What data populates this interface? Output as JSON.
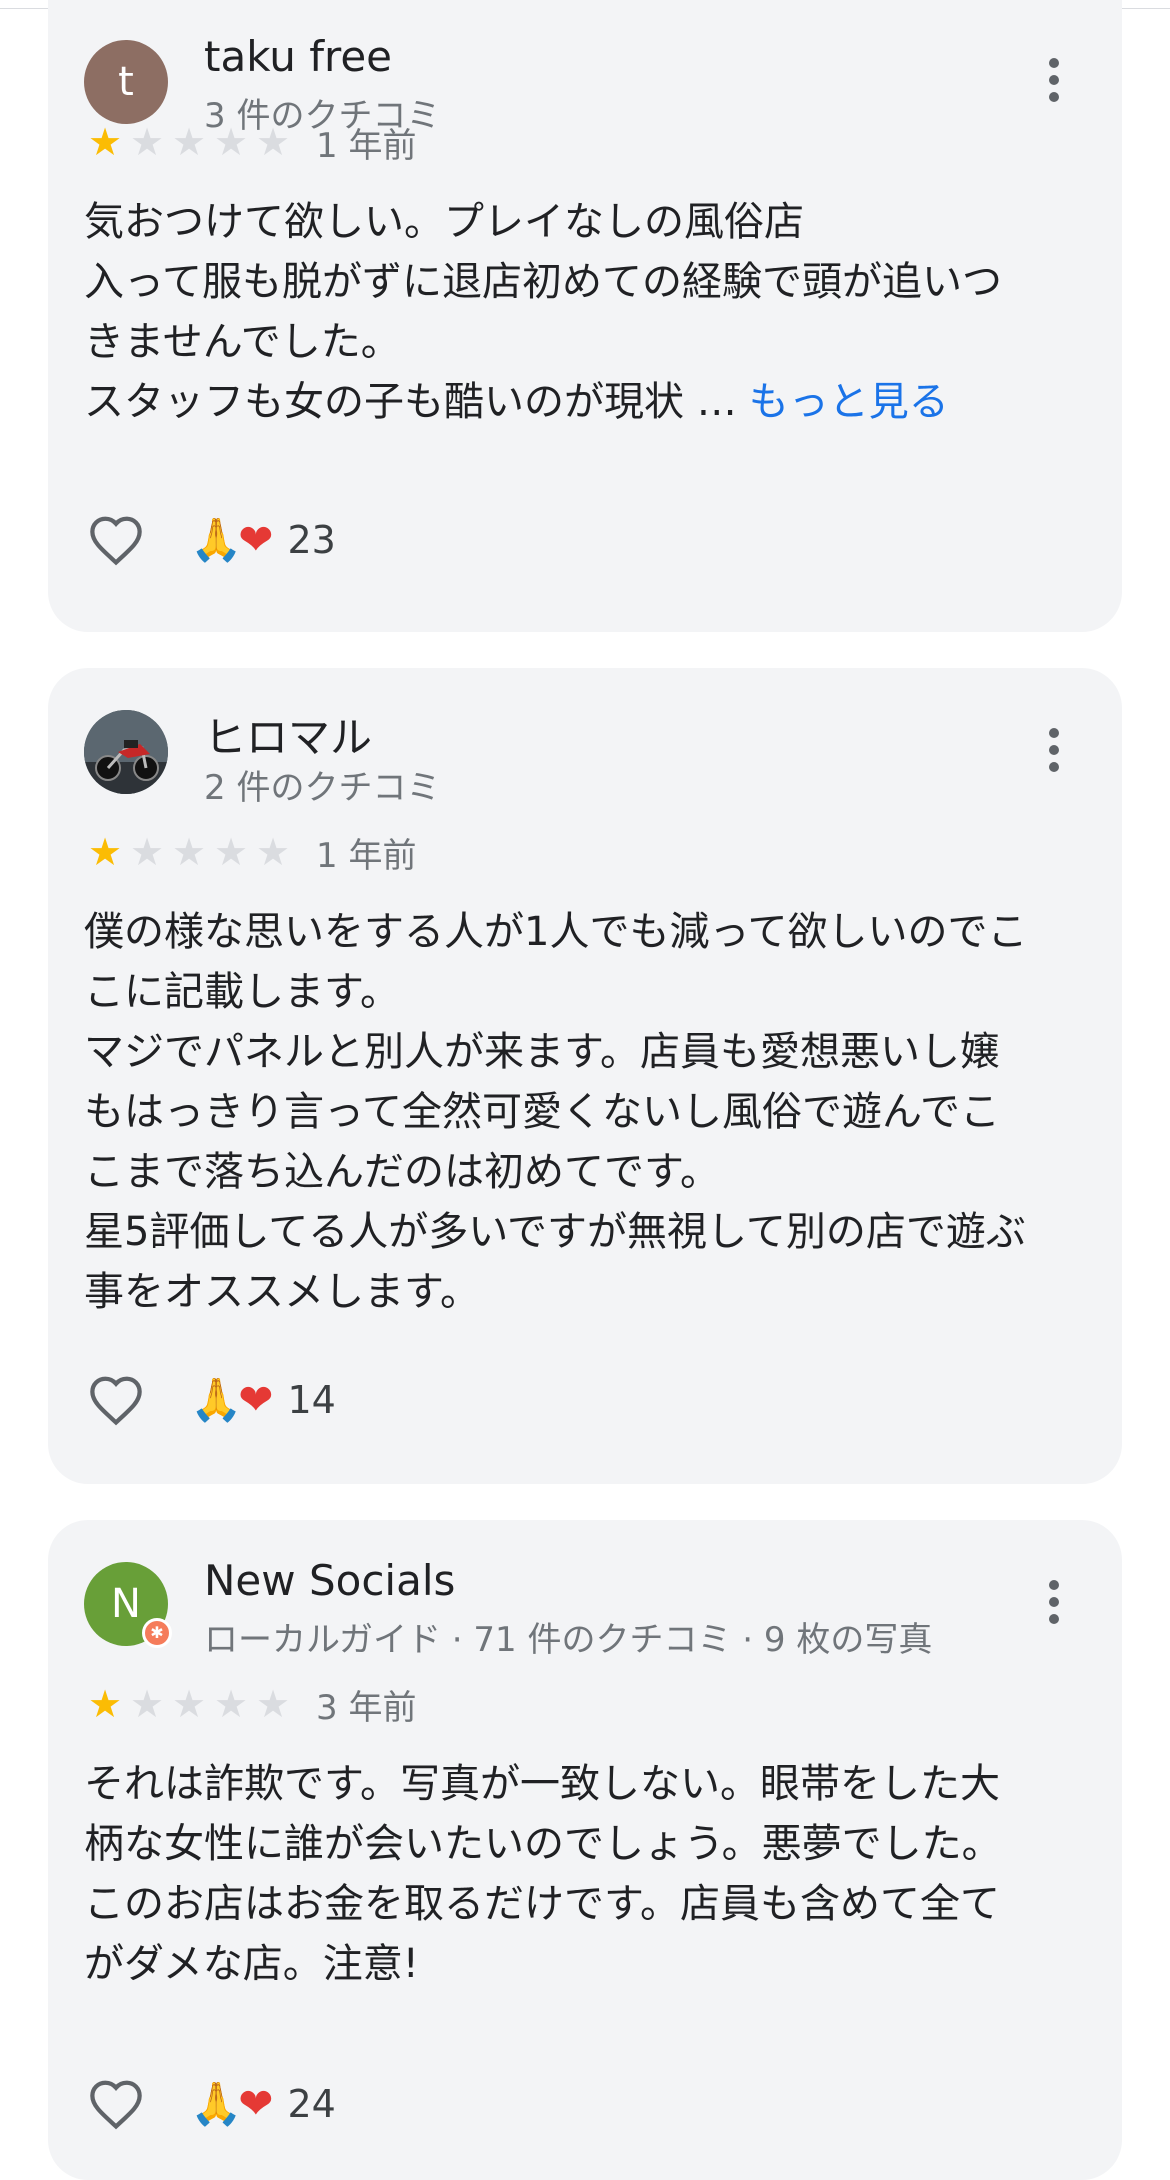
{
  "reviews": [
    {
      "avatar_letter": "t",
      "name": "taku free",
      "meta": "3 件のクチコミ",
      "stars": 1,
      "date": "1 年前",
      "lines": [
        "気おつけて欲しい。プレイなしの風俗店",
        "入って服も脱がずに退店初めての経験で頭が追いつ",
        "きませんでした。",
        "スタッフも女の子も酷いのが現状 …"
      ],
      "more_label": "もっと見る",
      "reaction_emojis": [
        "🙏",
        "❤"
      ],
      "reaction_count": "23"
    },
    {
      "avatar_letter": "",
      "avatar_icon": "motorcycle-photo",
      "name": "ヒロマル",
      "meta": "2 件のクチコミ",
      "stars": 1,
      "date": "1 年前",
      "lines": [
        "僕の様な思いをする人が1人でも減って欲しいのでこ",
        "こに記載します。",
        "マジでパネルと別人が来ます。店員も愛想悪いし嬢",
        "もはっきり言って全然可愛くないし風俗で遊んでこ",
        "こまで落ち込んだのは初めてです。",
        "星5評価してる人が多いですが無視して別の店で遊ぶ",
        "事をオススメします。"
      ],
      "reaction_emojis": [
        "🙏",
        "❤"
      ],
      "reaction_count": "14"
    },
    {
      "avatar_letter": "N",
      "name": "New Socials",
      "meta": "ローカルガイド · 71 件のクチコミ · 9 枚の写真",
      "stars": 1,
      "date": "3 年前",
      "lines": [
        "それは詐欺です。写真が一致しない。眼帯をした大",
        "柄な女性に誰が会いたいのでしょう。悪夢でした。",
        "このお店はお金を取るだけです。店員も含めて全て",
        "がダメな店。注意!"
      ],
      "reaction_emojis": [
        "🙏",
        "❤"
      ],
      "reaction_count": "24"
    }
  ],
  "colors": {
    "card_bg": "#f3f4f6",
    "star_filled": "#fbbc04",
    "star_empty": "#dadce0",
    "link": "#1a73e8",
    "meta_text": "#70757a"
  }
}
